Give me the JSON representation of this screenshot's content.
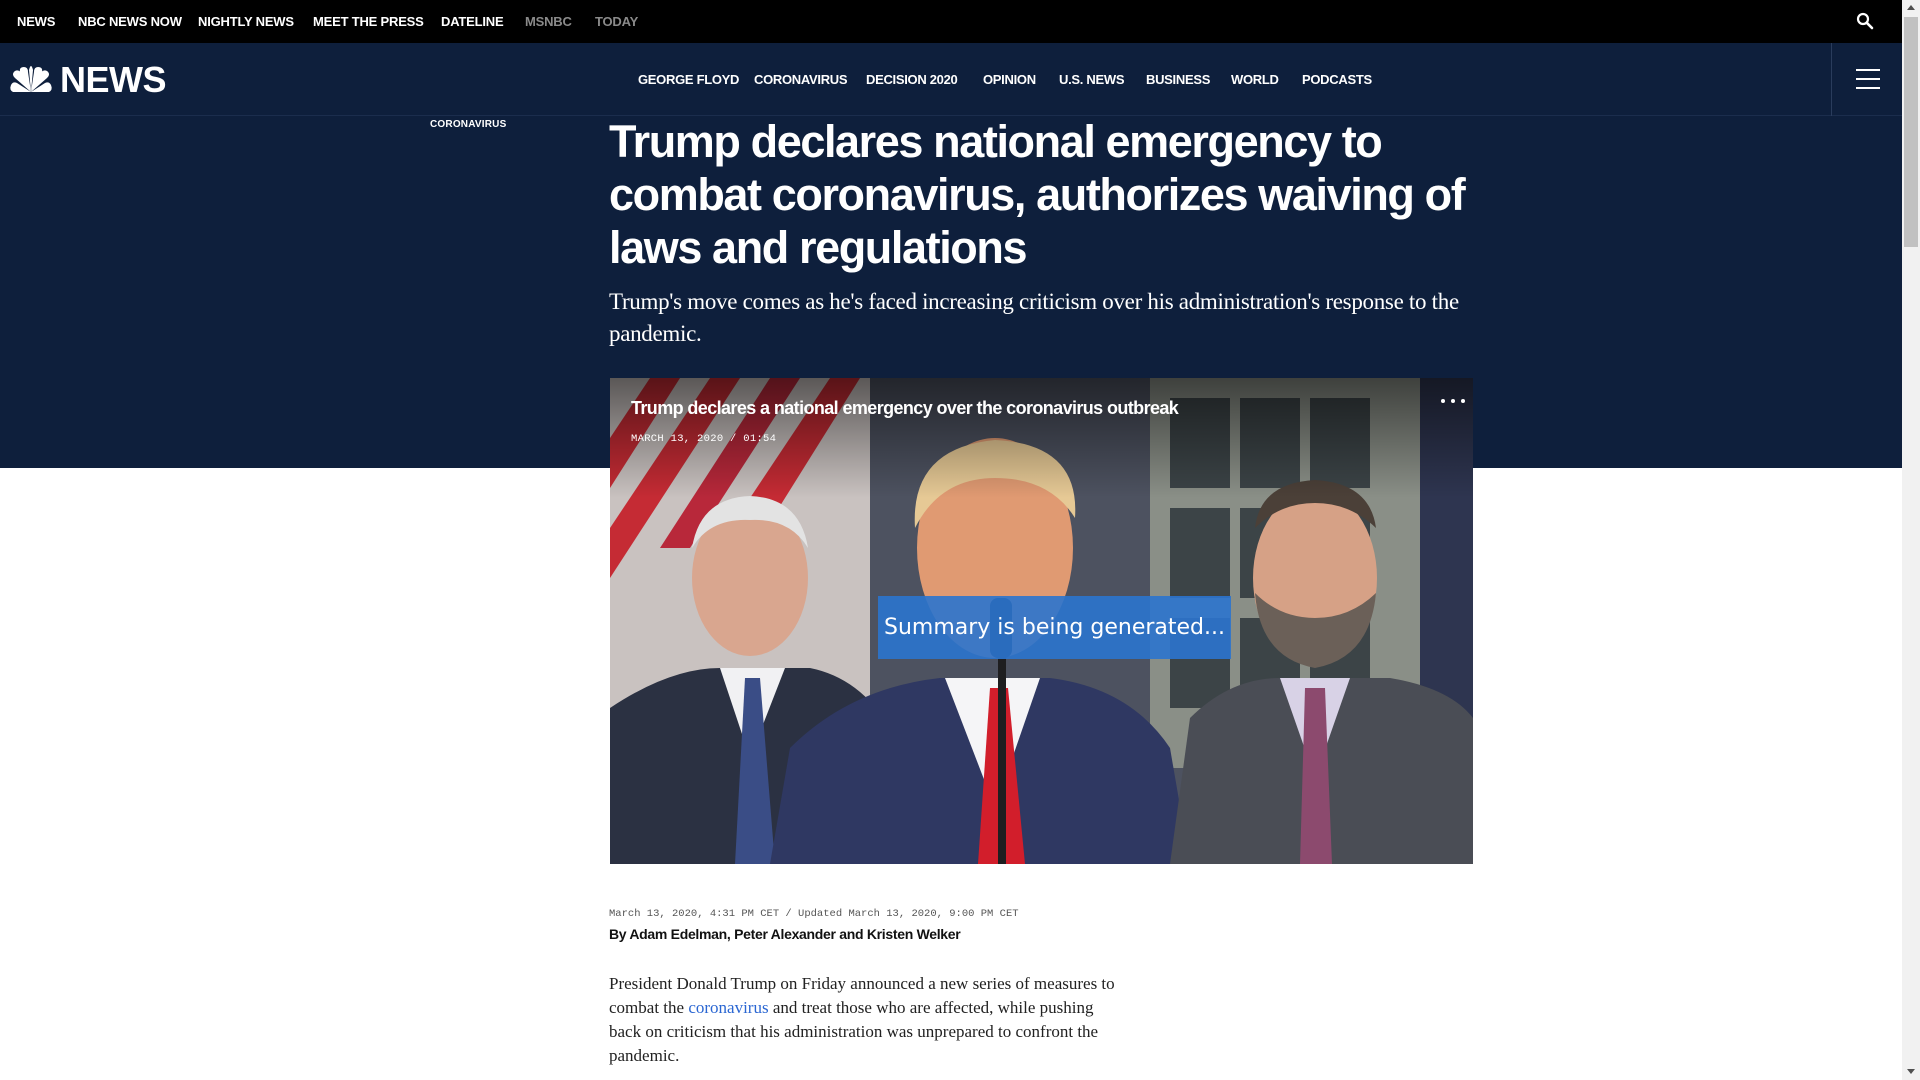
{
  "top_bar": {
    "items": [
      {
        "label": "NEWS",
        "dim": false
      },
      {
        "label": "NBC NEWS NOW",
        "dim": false
      },
      {
        "label": "NIGHTLY NEWS",
        "dim": false
      },
      {
        "label": "MEET THE PRESS",
        "dim": false
      },
      {
        "label": "DATELINE",
        "dim": false
      },
      {
        "label": "MSNBC",
        "dim": true
      },
      {
        "label": "TODAY",
        "dim": true
      }
    ],
    "search_icon": "search-icon"
  },
  "nav": {
    "logo_text": "NEWS",
    "logo_icon": "peacock-icon",
    "items": [
      {
        "label": "GEORGE FLOYD"
      },
      {
        "label": "CORONAVIRUS"
      },
      {
        "label": "DECISION 2020"
      },
      {
        "label": "OPINION"
      },
      {
        "label": "U.S. NEWS"
      },
      {
        "label": "BUSINESS"
      },
      {
        "label": "WORLD"
      },
      {
        "label": "PODCASTS"
      }
    ],
    "menu_icon": "hamburger-menu-icon"
  },
  "article": {
    "eyebrow": "CORONAVIRUS",
    "headline": "Trump declares national emergency to combat coronavirus, authorizes waiving of laws and regulations",
    "dek": "Trump's move comes as he's faced increasing criticism over his administration's response to the pandemic.",
    "video": {
      "title": "Trump declares a national emergency over the coronavirus outbreak",
      "meta": "MARCH 13, 2020 / 01:54",
      "overlay": "Summary is being generated...",
      "more_icon": "more-options-icon"
    },
    "dateline": "March 13, 2020, 4:31 PM CET / Updated March 13, 2020, 9:00 PM CET",
    "byline_prefix": "By ",
    "byline_authors": "Adam Edelman, Peter Alexander and Kristen Welker",
    "body": {
      "before": "President Donald Trump on Friday announced a new series of measures to combat the ",
      "link": "coronavirus",
      "after": " and treat those who are affected, while pushing back on criticism that his administration was unprepared to confront the pandemic."
    }
  },
  "colors": {
    "top_bar_bg": "#000000",
    "navy": "#0e1f3c",
    "link": "#2a66d2",
    "summary_overlay": "#2b74ce"
  }
}
